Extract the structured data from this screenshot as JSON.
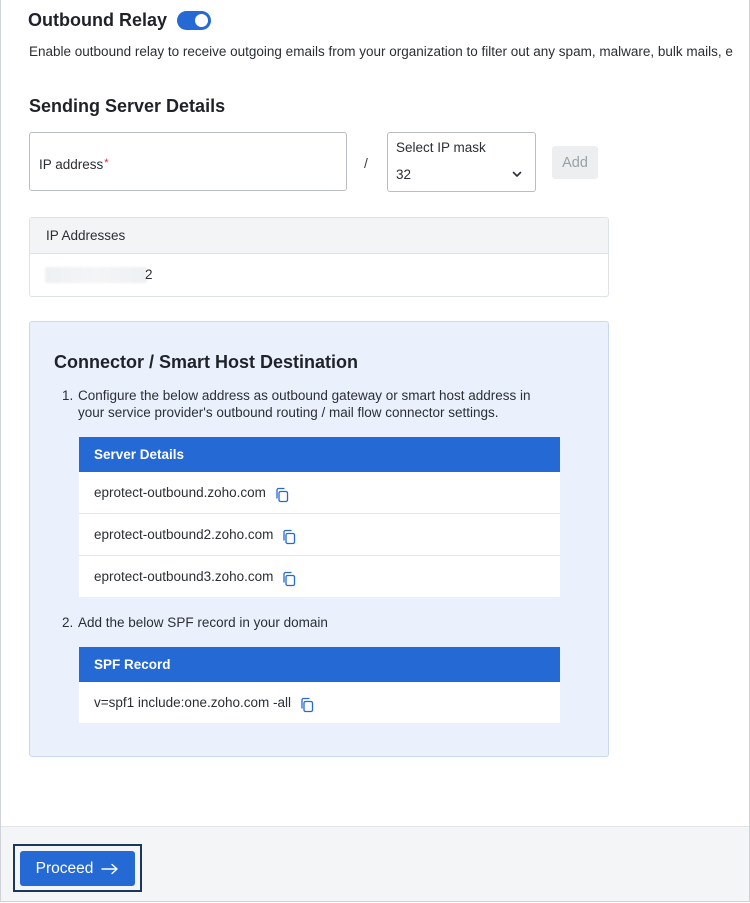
{
  "relay": {
    "title": "Outbound Relay",
    "toggle_on": true,
    "description": "Enable outbound relay to receive outgoing emails from your organization to filter out any spam, malware, bulk mails, e"
  },
  "sending_server": {
    "title": "Sending Server Details",
    "ip_label": "IP address",
    "required_mark": "*",
    "separator": "/",
    "mask_label": "Select IP mask",
    "mask_value": "32",
    "add_label": "Add"
  },
  "ip_table": {
    "header": "IP Addresses",
    "rows": [
      {
        "visible_suffix": "2"
      }
    ]
  },
  "connector": {
    "title": "Connector / Smart Host Destination",
    "step1": {
      "num": "1.",
      "text": "Configure the below address as outbound gateway or smart host address in your service provider's outbound routing / mail flow connector settings."
    },
    "server_table": {
      "header": "Server Details",
      "rows": [
        "eprotect-outbound.zoho.com",
        "eprotect-outbound2.zoho.com",
        "eprotect-outbound3.zoho.com"
      ]
    },
    "step2": {
      "num": "2.",
      "text": "Add the below SPF record in your domain"
    },
    "spf_table": {
      "header": "SPF Record",
      "rows": [
        "v=spf1 include:one.zoho.com -all"
      ]
    }
  },
  "footer": {
    "proceed_label": "Proceed"
  },
  "colors": {
    "accent": "#2469d4",
    "required": "#d6293e",
    "panel_bg": "#eaf1fd"
  }
}
